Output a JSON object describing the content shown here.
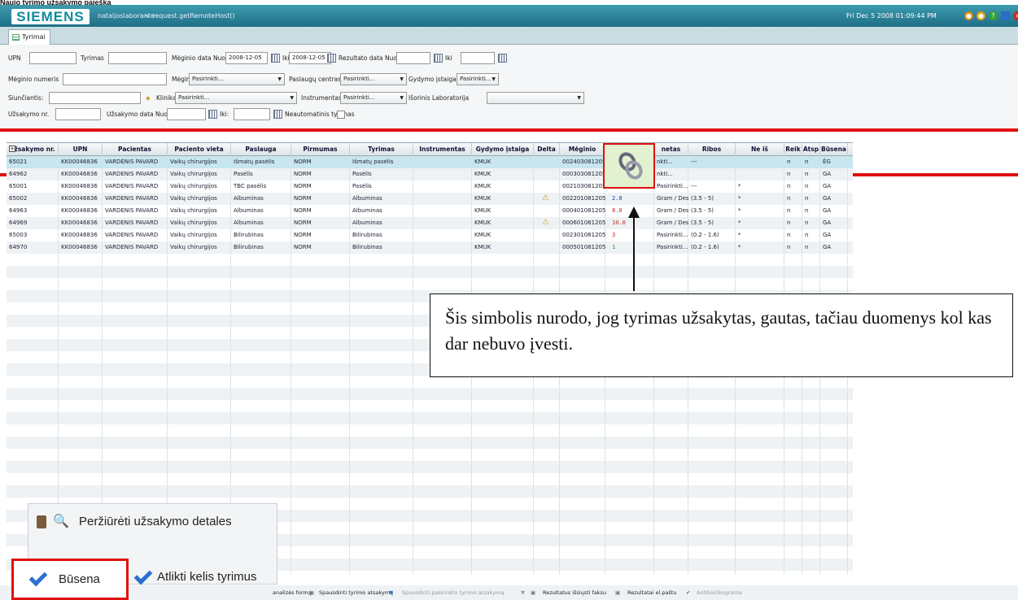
{
  "doc_title": "Naujo tyrimo užsakymo paieška",
  "header": {
    "logo": "SIEMENS",
    "username": "nataljoslaborante",
    "host": "< request.getRemoteHost()",
    "datetime": "Fri Dec 5 2008 01:09:44 PM"
  },
  "tab": {
    "label": "Tyrimai"
  },
  "filters": {
    "upn": "UPN",
    "tyrimas": "Tyrimas",
    "meginio_data_nuo": "Mėginio data Nuo",
    "date_from": "2008-12-05",
    "iki": "Iki",
    "date_to": "2008-12-05",
    "rezultato_data_nuo": "Rezultato data Nuo",
    "meginio_numeris": "Mėginio numeris",
    "meginys": "Mėginys",
    "pasirinkti": "Pasirinkti...",
    "paslaugu_centras": "Paslaugų centras",
    "gydymo_istaiga": "Gydymo įstaiga",
    "siunciantis": "Siunčiantis:",
    "klinika": "Klinika",
    "instrumentas": "Instrumentas",
    "isorine_laboratorija": "Išorinis Laboratorija",
    "uzsakymo_nr": "Užsakymo nr.",
    "uzsakymo_data_nuo": "Užsakymo data Nuo:",
    "iki2": "Iki:",
    "neautomatinis": "Neautomatinis tyrimas"
  },
  "columns": [
    "Užsakymo nr.",
    "UPN",
    "Pacientas",
    "Paciento vieta",
    "Paslauga",
    "Pirmumas",
    "Tyrimas",
    "Instrumentas",
    "Gydymo įstaiga",
    "Delta",
    "Mėginio nume",
    "",
    "netas",
    "Ribos",
    "Ne iš analizato",
    "Reik",
    "Atsp",
    "Būsena"
  ],
  "rows": [
    [
      "65021",
      "KK00046836",
      "VARDENIS PAVARD",
      "Vaikų chirurgijos",
      "Išmatų pasėlis",
      "NORM",
      "Išmatų pasėlis",
      "",
      "KMUK",
      "",
      "002403081205",
      "",
      "nkti...",
      "---",
      "",
      "n",
      "n",
      "ĖG"
    ],
    [
      "64962",
      "KK00046836",
      "VARDENIS PAVARD",
      "Vaikų chirurgijos",
      "Pasėlis",
      "NORM",
      "Pasėlis",
      "",
      "KMUK",
      "",
      "000303081205",
      "",
      "nkti...",
      "",
      "",
      "n",
      "n",
      "GA"
    ],
    [
      "65001",
      "KK00046836",
      "VARDENIS PAVARD",
      "Vaikų chirurgijos",
      "TBC pasėlis",
      "NORM",
      "Pasėlis",
      "",
      "KMUK",
      "",
      "002103081205",
      "",
      "Pasirinkti...",
      "---",
      "*",
      "n",
      "n",
      "GA"
    ],
    [
      "65002",
      "KK00046836",
      "VARDENIS PAVARD",
      "Vaikų chirurgijos",
      "Albuminas",
      "NORM",
      "Albuminas",
      "",
      "KMUK",
      "",
      "002201081205",
      "2.0",
      "Gram / Des",
      "(3.5 - 5)",
      "*",
      "n",
      "n",
      "GA"
    ],
    [
      "64963",
      "KK00046836",
      "VARDENIS PAVARD",
      "Vaikų chirurgijos",
      "Albuminas",
      "NORM",
      "Albuminas",
      "",
      "KMUK",
      "",
      "000401081205",
      "8.0",
      "Gram / Des",
      "(3.5 - 5)",
      "*",
      "n",
      "n",
      "GA"
    ],
    [
      "64969",
      "KK00046836",
      "VARDENIS PAVARD",
      "Vaikų chirurgijos",
      "Albuminas",
      "NORM",
      "Albuminas",
      "",
      "KMUK",
      "",
      "000601081205",
      "10.0",
      "Gram / Des",
      "(3.5 - 5)",
      "*",
      "n",
      "n",
      "GA"
    ],
    [
      "65003",
      "KK00046836",
      "VARDENIS PAVARD",
      "Vaikų chirurgijos",
      "Bilirubinas",
      "NORM",
      "Bilirubinas",
      "",
      "KMUK",
      "",
      "002301081205",
      "3",
      "Pasirinkti...",
      "(0.2 - 1.6)",
      "*",
      "n",
      "n",
      "GA"
    ],
    [
      "64970",
      "KK00046836",
      "VARDENIS PAVARD",
      "Vaikų chirurgijos",
      "Bilirubinas",
      "NORM",
      "Bilirubinas",
      "",
      "KMUK",
      "",
      "000501081205",
      "1",
      "Pasirinkti...",
      "(0.2 - 1.6)",
      "*",
      "n",
      "n",
      "GA"
    ]
  ],
  "callout": {
    "text": "Šis simbolis nurodo, jog tyrimas užsakytas, gautas, tačiau duomenys kol kas dar nebuvo įvesti."
  },
  "popup": {
    "details": "Peržiūrėti užsakymo detales",
    "busena": "Būsena",
    "kelis": "Atlikti kelis tyrimus"
  },
  "bottombar": {
    "analizes": "analizės formą",
    "spausdinti": "Spausdinti tyrimo atsakymą",
    "spausdinti_pas": "Spausdinti pasirinkto tyrimo atsakymą",
    "faksu": "Rezultatus išsiųsti faksu",
    "pastu": "Rezultatai el.paštu",
    "antibiotikograma": "Antibiotikograma"
  },
  "colors": {
    "accent": "#1f6f85",
    "highlight": "#e01010",
    "check": "#2b6fd0"
  }
}
